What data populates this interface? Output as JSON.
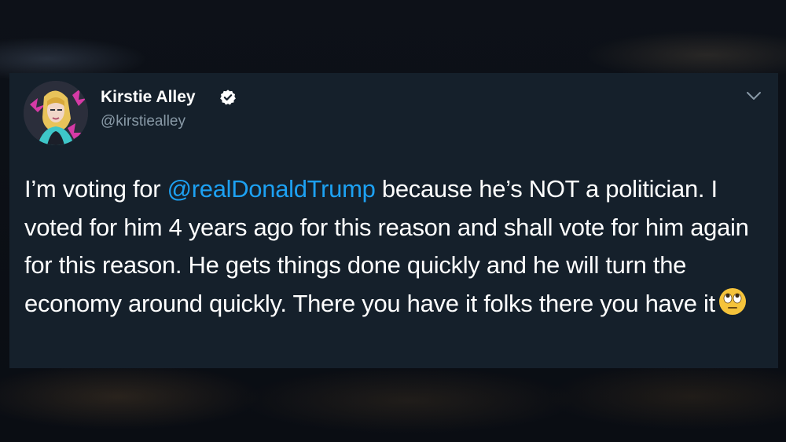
{
  "tweet": {
    "author_name": "Kirstie Alley",
    "author_handle": "@kirstiealley",
    "verified": true,
    "text_part1": "I’m voting for ",
    "mention": "@realDonaldTrump",
    "text_part2": " because he’s NOT a politician. I voted for him 4 years ago for this reason and shall vote for him again for this reason. He gets things done quickly and he will turn the economy around quickly. There you have it folks there you have it",
    "emoji": "face-with-rolling-eyes-emoji"
  },
  "icons": {
    "verified": "verified-badge-icon",
    "menu": "chevron-down-icon"
  },
  "colors": {
    "card_background": "#15202b",
    "link": "#1da1f2",
    "secondary_text": "#8899a6",
    "verified_badge": "#ffffff"
  }
}
